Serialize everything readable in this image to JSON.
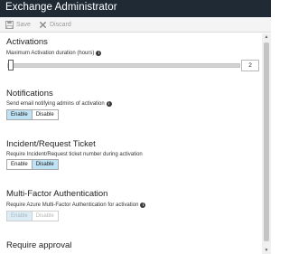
{
  "window": {
    "title": "Exchange Administrator"
  },
  "toolbar": {
    "save_label": "Save",
    "discard_label": "Discard"
  },
  "activations": {
    "title": "Activations",
    "duration_label": "Maximum Activation duration (hours)",
    "duration_value": "2",
    "duration_max_hours": 24
  },
  "notifications": {
    "title": "Notifications",
    "description": "Send email notifying admins of activation",
    "enable_label": "Enable",
    "disable_label": "Disable",
    "selected": "Enable"
  },
  "ticket": {
    "title": "Incident/Request Ticket",
    "description": "Require Incident/Request ticket number during activation",
    "enable_label": "Enable",
    "disable_label": "Disable",
    "selected": "Disable"
  },
  "mfa": {
    "title": "Multi-Factor Authentication",
    "description": "Require Azure Multi-Factor Authentication for activation",
    "enable_label": "Enable",
    "disable_label": "Disable",
    "selected": "Enable",
    "disabled": true
  },
  "approval": {
    "title": "Require approval"
  },
  "colors": {
    "titlebar": "#1f2a35",
    "toggle_selected": "#bfe3f4"
  }
}
